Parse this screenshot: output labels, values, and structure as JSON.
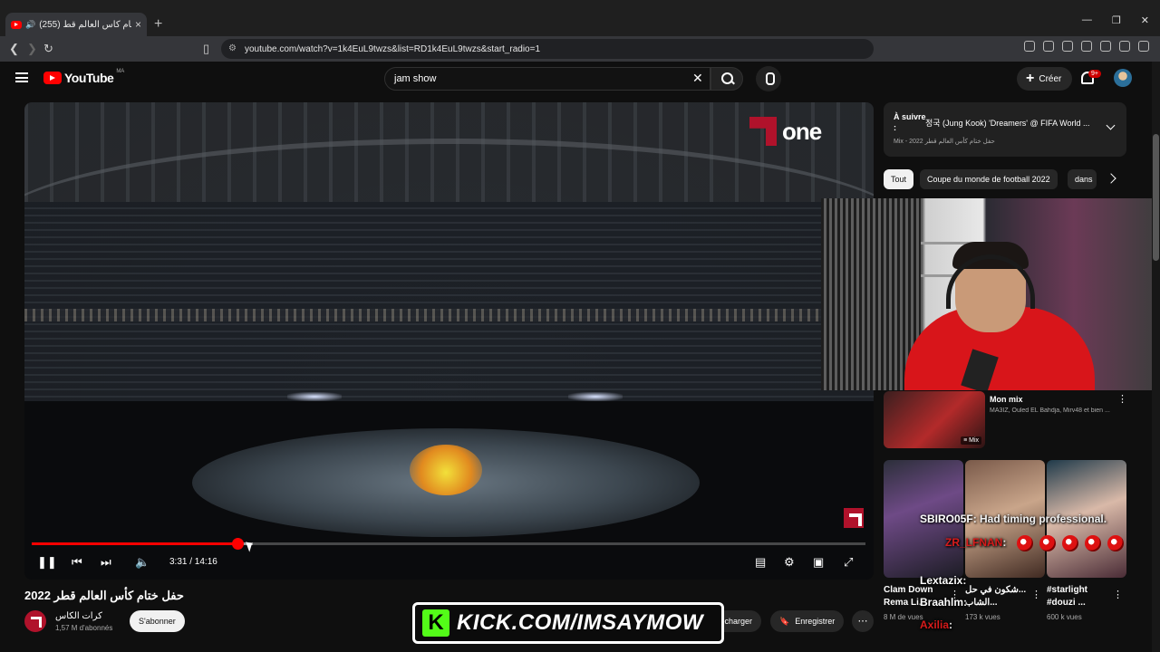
{
  "browser": {
    "tab_title": "(255) حفل ختام كأس العالم قط...",
    "url": "youtube.com/watch?v=1k4EuL9twzs&list=RD1k4EuL9twzs&start_radio=1"
  },
  "header": {
    "logo_text": "YouTube",
    "country_code": "MA",
    "search_value": "jam show",
    "create_label": "Créer",
    "notif_count": "9+"
  },
  "player": {
    "channel_watermark": "one",
    "current_time": "3:31",
    "duration": "14:16",
    "time_display": "3:31 / 14:16",
    "progress_fraction": 0.247,
    "buffer_fraction": 0.265
  },
  "video": {
    "title": "حفل ختام كأس العالم قطر 2022",
    "channel_name": "كرات الكاس",
    "subscribers": "1,57 M d'abonnés",
    "subscribe_label": "S'abonner",
    "download_label": "Télécharger",
    "save_label": "Enregistrer"
  },
  "sidebar": {
    "up_next_label": "À suivre :",
    "up_next_title": "정국 (Jung Kook) 'Dreamers' @ FIFA World ...",
    "up_next_sub": "Mix - 2022 حفل ختام كأس العالم قطر",
    "chips": [
      "Tout",
      "Coupe du monde de football 2022",
      "dans"
    ],
    "mix_card": {
      "title": "Mon mix",
      "subtitle": "MA3IZ, Ouled EL Bahdja, Mirv48 et bien ...",
      "badge": "Mix"
    },
    "shorts": [
      {
        "title": "Clam Down",
        "title2": "Rema Li...",
        "views": "8 M de vues"
      },
      {
        "title": "شكون في حل...",
        "title2": "الشاب...",
        "views": "173 k vues"
      },
      {
        "title": "#starlight",
        "title2": "#douzi ...",
        "views": "600 k vues"
      }
    ]
  },
  "overlay": {
    "kick_letter": "K",
    "kick_text": "KICK.COM/IMSAYMOW",
    "chat": [
      {
        "user": "SBIRO05F",
        "text": ": Had timing professional.",
        "color": "#ffffff"
      },
      {
        "user": "ZR_LFNAN",
        "text": ":",
        "color": "#d81b1b"
      },
      {
        "user": "Lextazix",
        "text": ":",
        "color": "#ffffff"
      },
      {
        "user": "Braahlm",
        "text": ":",
        "color": "#ffffff"
      },
      {
        "user": "Axilia",
        "text": ":",
        "color": "#d81b1b"
      }
    ]
  },
  "colors": {
    "accent": "#ff0000",
    "kick_green": "#53fc18",
    "brand_red": "#b0122b"
  }
}
